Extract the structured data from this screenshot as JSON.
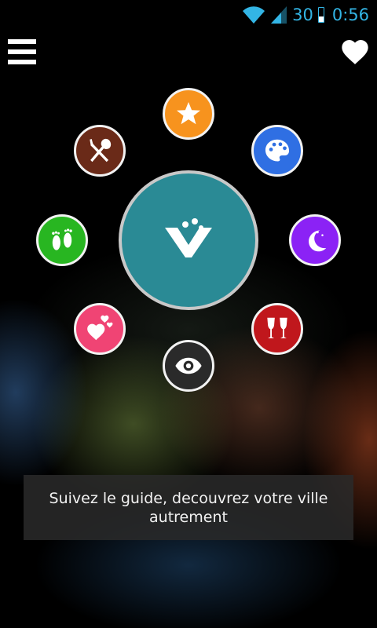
{
  "status_bar": {
    "wifi_icon": "wifi-icon",
    "signal_icon": "signal-icon",
    "battery_text": "30",
    "time": "0:56",
    "accent_color": "#33b5e5"
  },
  "header": {
    "menu_icon": "menu-icon",
    "favorites_icon": "heart-icon"
  },
  "center_button": {
    "icon": "v-logo-icon",
    "color": "#2a8a95"
  },
  "categories": [
    {
      "name": "star",
      "icon": "star-icon",
      "color": "#f7931e"
    },
    {
      "name": "art",
      "icon": "palette-icon",
      "color": "#2f6fe3"
    },
    {
      "name": "night",
      "icon": "moon-icon",
      "color": "#8b22f5"
    },
    {
      "name": "drinks",
      "icon": "champagne-icon",
      "color": "#c0171c"
    },
    {
      "name": "sightseeing",
      "icon": "eye-icon",
      "color": "#2a2a2a"
    },
    {
      "name": "love",
      "icon": "hearts-icon",
      "color": "#f04474"
    },
    {
      "name": "walk",
      "icon": "footprints-icon",
      "color": "#28b621"
    },
    {
      "name": "food",
      "icon": "fork-spoon-icon",
      "color": "#6a2a18"
    }
  ],
  "banner_text": "Suivez le guide, decouvrez votre ville autrement"
}
